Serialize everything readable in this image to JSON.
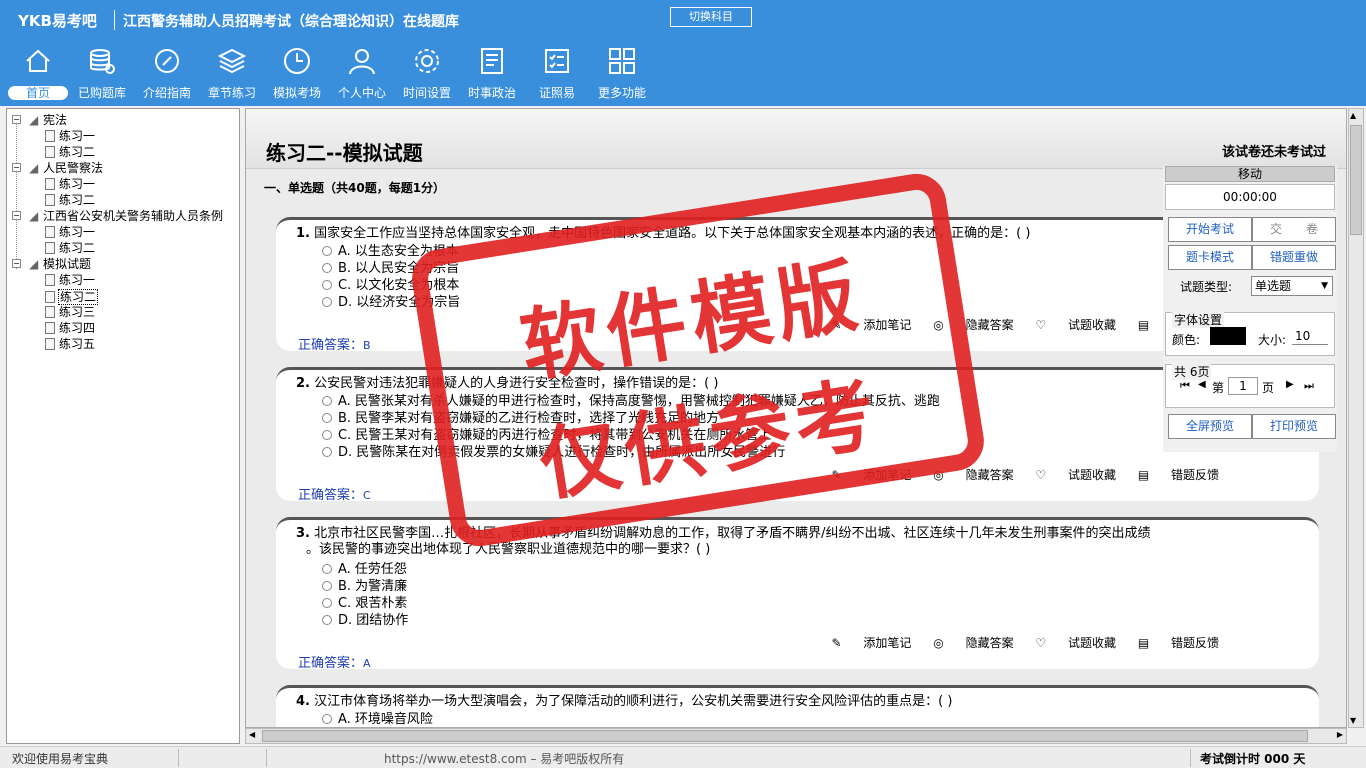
{
  "app": {
    "brand": "YKB易考吧",
    "title": "江西警务辅助人员招聘考试（综合理论知识）在线题库",
    "switch_label": "切换科目"
  },
  "nav": [
    {
      "label": "首页",
      "icon": "home-icon"
    },
    {
      "label": "已购题库",
      "icon": "database-icon"
    },
    {
      "label": "介绍指南",
      "icon": "compass-icon"
    },
    {
      "label": "章节练习",
      "icon": "layers-icon"
    },
    {
      "label": "模拟考场",
      "icon": "clock-icon"
    },
    {
      "label": "个人中心",
      "icon": "user-icon"
    },
    {
      "label": "时间设置",
      "icon": "gear-icon"
    },
    {
      "label": "时事政治",
      "icon": "news-icon"
    },
    {
      "label": "证照易",
      "icon": "checklist-icon"
    },
    {
      "label": "更多功能",
      "icon": "grid-icon"
    }
  ],
  "tree": [
    {
      "label": "宪法",
      "children": [
        "练习一",
        "练习二"
      ]
    },
    {
      "label": "人民警察法",
      "children": [
        "练习一",
        "练习二"
      ]
    },
    {
      "label": "江西省公安机关警务辅助人员条例",
      "children": [
        "练习一",
        "练习二"
      ]
    },
    {
      "label": "模拟试题",
      "children": [
        "练习一",
        "练习二",
        "练习三",
        "练习四",
        "练习五"
      ]
    }
  ],
  "paper": {
    "title": "练习二--模拟试题",
    "status": "该试卷还未考试过",
    "section": "一、单选题（共40题，每题1分）"
  },
  "actions": {
    "note": "添加笔记",
    "hide": "隐藏答案",
    "fav": "试题收藏",
    "report": "错题反馈"
  },
  "answer_label": "正确答案：",
  "questions": [
    {
      "num": "1.",
      "text": "国家安全工作应当坚持总体国家安全观，走中国特色国家安全道路。以下关于总体国家安全观基本内涵的表述，正确的是：( )",
      "options": [
        "A. 以生态安全为根本",
        "B. 以人民安全为宗旨",
        "C. 以文化安全为根本",
        "D. 以经济安全为宗旨"
      ],
      "answer": "B"
    },
    {
      "num": "2.",
      "text": "公安民警对违法犯罪嫌疑人的人身进行安全检查时，操作错误的是：( )",
      "options": [
        "A. 民警张某对有杀人嫌疑的甲进行检查时，保持高度警惕，用警械控制犯罪嫌疑人乙，防止其反抗、逃跑",
        "B. 民警李某对有盗窃嫌疑的乙进行检查时，选择了光线充足的地方",
        "C. 民警王某对有盗窃嫌疑的丙进行检查时，将其带到公安机关在厕所水管上",
        "D. 民警陈某在对倒卖假发票的女嫌疑人进行检查时，由所属派出所女民警进行"
      ],
      "answer": "C"
    },
    {
      "num": "3.",
      "text": "北京市社区民警李国…扎根社区，长期从事矛盾纠纷调解劝息的工作，取得了矛盾不瞒界/纠纷不出城、社区连续十几年未发生刑事案件的突出成绩",
      "text2": "。该民警的事迹突出地体现了人民警察职业道德规范中的哪一要求？( )",
      "options": [
        "A. 任劳任怨",
        "B. 为警清廉",
        "C. 艰苦朴素",
        "D. 团结协作"
      ],
      "answer": "A"
    },
    {
      "num": "4.",
      "text": "汉江市体育场将举办一场大型演唱会，为了保障活动的顺利进行，公安机关需要进行安全风险评估的重点是：( )",
      "options": [
        "A. 环境噪音风险"
      ],
      "answer": ""
    }
  ],
  "right": {
    "move": "移动",
    "timer": "00:00:00",
    "start": "开始考试",
    "submit": "交　　卷",
    "card": "题卡模式",
    "redo": "错题重做",
    "type_label": "试题类型:",
    "type_value": "单选题",
    "font_title": "字体设置",
    "color_label": "颜色:",
    "size_label": "大小:",
    "size_value": "10",
    "pages_title": "共 6页",
    "page_prefix": "第",
    "page_value": "1",
    "page_suffix": "页",
    "fullscreen": "全屏预览",
    "print": "打印预览"
  },
  "stamp": {
    "line1": "软件模版",
    "line2": "仅供参考"
  },
  "status": {
    "welcome": "欢迎使用易考宝典",
    "copyright": "https://www.etest8.com – 易考吧版权所有",
    "countdown": "考试倒计时 000 天"
  },
  "colors": {
    "header": "#3a8fdc",
    "stamp": "#e02020",
    "answer": "#2040b0"
  }
}
